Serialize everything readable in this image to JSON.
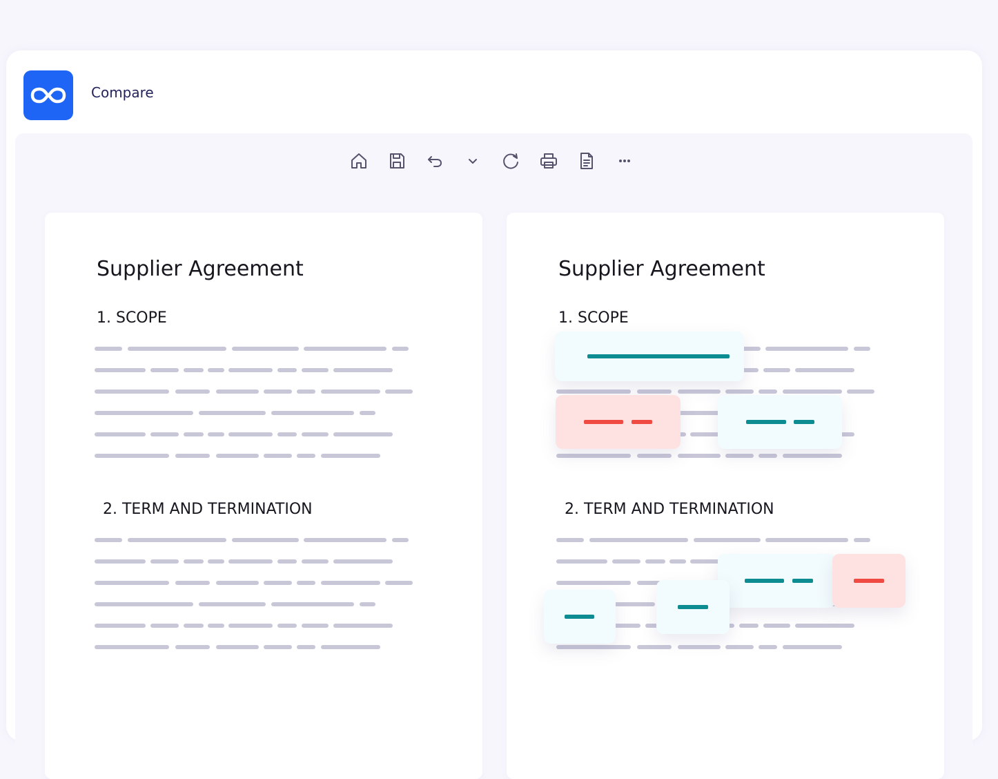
{
  "app": {
    "title": "Compare",
    "logo_icon": "infinity-link-icon",
    "accent_color": "#1e64f5"
  },
  "toolbar": {
    "buttons": [
      {
        "name": "home-icon"
      },
      {
        "name": "save-icon"
      },
      {
        "name": "undo-icon"
      },
      {
        "name": "chevron-down-icon"
      },
      {
        "name": "refresh-icon"
      },
      {
        "name": "print-icon"
      },
      {
        "name": "document-icon"
      },
      {
        "name": "more-icon"
      }
    ]
  },
  "documents": {
    "original": {
      "title": "Supplier Agreement",
      "section1": "1. SCOPE",
      "section2": "2. TERM AND TERMINATION"
    },
    "revised": {
      "title": "Supplier Agreement",
      "section1": "1. SCOPE",
      "section2": "2. TERM AND TERMINATION"
    }
  },
  "colors": {
    "addition": "#0d8d92",
    "deletion": "#ef4b43",
    "addition_bg": "#f2fbfd",
    "deletion_bg": "#fde2e1",
    "placeholder_text": "#c8c7d8"
  }
}
